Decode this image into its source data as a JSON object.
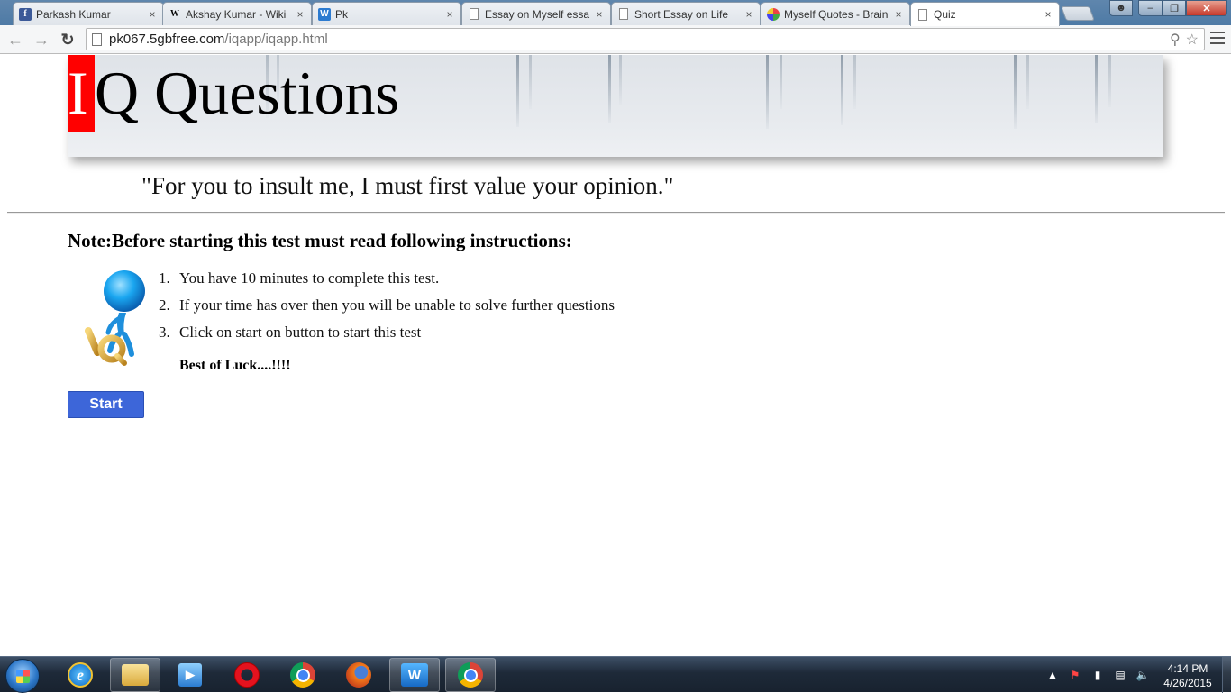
{
  "browser": {
    "tabs": [
      {
        "title": "Parkash Kumar",
        "icon": "facebook-icon"
      },
      {
        "title": "Akshay Kumar - Wiki",
        "icon": "wikipedia-icon"
      },
      {
        "title": "Pk",
        "icon": "webstarts-icon"
      },
      {
        "title": "Essay on Myself essa",
        "icon": "page-icon"
      },
      {
        "title": "Short Essay on Life",
        "icon": "page-icon"
      },
      {
        "title": "Myself Quotes - Brain",
        "icon": "brainyquote-icon"
      },
      {
        "title": "Quiz",
        "icon": "page-icon"
      }
    ],
    "active_tab": 6,
    "url_host": "pk067.5gbfree.com",
    "url_path": "/iqapp/iqapp.html",
    "close_glyph": "×"
  },
  "page": {
    "title_first_letter": "I",
    "title_rest": "Q Questions",
    "quote": "\"For you to insult me, I must first value your opinion.\"",
    "note": "Note:Before starting this test must read following instructions:",
    "instructions": [
      "You have 10 minutes to complete this test.",
      "If your time has over then you will be unable to solve further questions",
      "Click on start on button to start this test"
    ],
    "luck": "Best of Luck....!!!!",
    "start_label": "Start"
  },
  "taskbar": {
    "apps": [
      "internet-explorer-icon",
      "windows-explorer-icon",
      "media-player-icon",
      "opera-icon",
      "chrome-icon",
      "firefox-icon",
      "webstorm-icon",
      "chrome-icon"
    ],
    "time": "4:14 PM",
    "date": "4/26/2015"
  }
}
